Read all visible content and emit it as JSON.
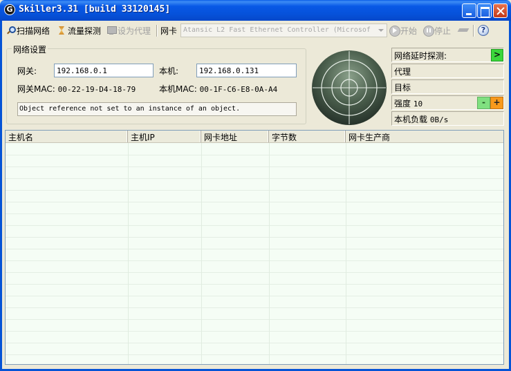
{
  "window": {
    "app_icon_letter": "G",
    "title": "Skiller3.31 [build 33120145]"
  },
  "toolbar": {
    "scan_label": "扫描网络",
    "traffic_label": "流量探测",
    "proxy_label": "设为代理",
    "nic_label": "网卡",
    "nic_value": "Atansic L2 Fast Ethernet Controller (Microsof",
    "start_label": "开始",
    "stop_label": "停止",
    "help_glyph": "?"
  },
  "network_settings": {
    "group_title": "网络设置",
    "gateway_label": "网关:",
    "gateway_ip": "192.168.0.1",
    "local_label": "本机:",
    "local_ip": "192.168.0.131",
    "gateway_mac_label": "网关MAC:",
    "gateway_mac": "00-22-19-D4-18-79",
    "local_mac_label": "本机MAC:",
    "local_mac": "00-1F-C6-E8-0A-A4",
    "error_message": "Object reference not set to an instance of an object."
  },
  "status_panel": {
    "latency_label": "网络延时探测:",
    "go_glyph": ">",
    "proxy_label": "代理",
    "target_label": "目标",
    "intensity_label": "强度",
    "intensity_value": "10",
    "minus_glyph": "-",
    "plus_glyph": "+",
    "load_label": "本机负载",
    "load_value": "0B/s"
  },
  "host_table": {
    "columns": [
      "主机名",
      "主机IP",
      "网卡地址",
      "字节数",
      "网卡生产商"
    ],
    "rows": []
  },
  "colors": {
    "titlebar": "#0651d9",
    "go_button": "#3bd63b",
    "minus_button": "#80e080",
    "plus_button": "#f89a1c",
    "table_background": "#f5fdf5"
  },
  "icons": {
    "scan": "magnifier-icon",
    "traffic": "hourglass-icon",
    "proxy": "monitor-icon",
    "start": "play-circle-icon",
    "stop": "pause-circle-icon",
    "sniff": "cap-icon",
    "help": "help-icon"
  }
}
